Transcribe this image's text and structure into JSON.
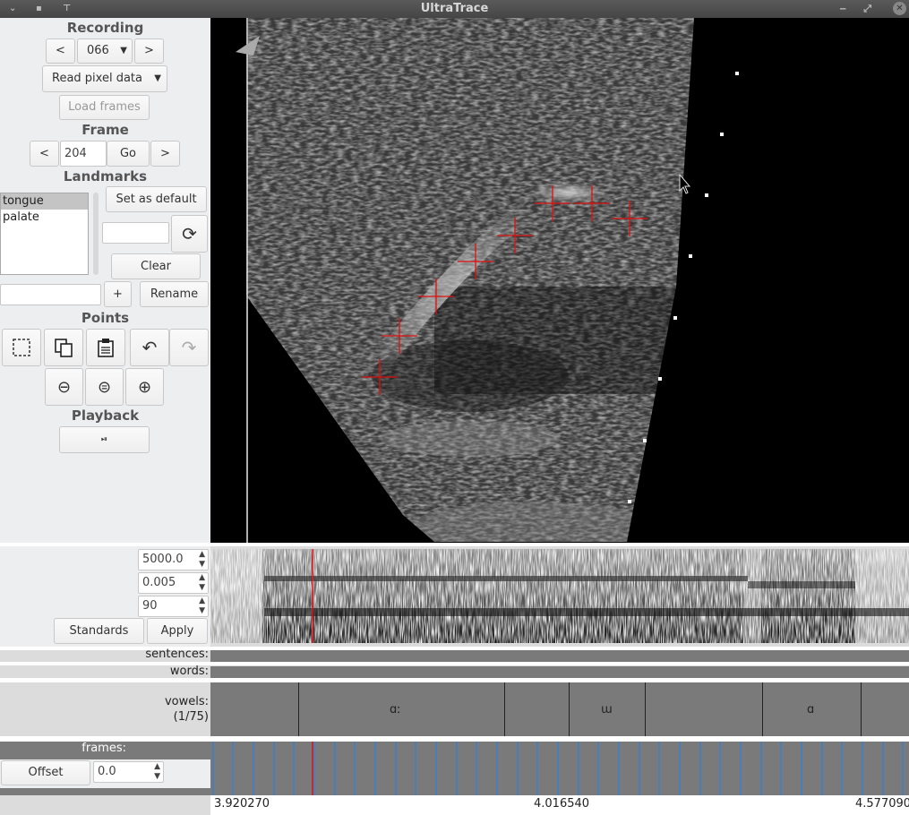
{
  "window": {
    "title": "UltraTrace"
  },
  "recording": {
    "header": "Recording",
    "prev": "<",
    "next": ">",
    "value": "066",
    "mode": "Read pixel data",
    "load": "Load frames"
  },
  "frame": {
    "header": "Frame",
    "prev": "<",
    "next": ">",
    "value": "204",
    "go": "Go"
  },
  "landmarks": {
    "header": "Landmarks",
    "items": [
      "tongue",
      "palate"
    ],
    "selected": "tongue",
    "set_default": "Set as default",
    "clear": "Clear",
    "add": "+",
    "rename": "Rename"
  },
  "points": {
    "header": "Points"
  },
  "playback": {
    "header": "Playback"
  },
  "spectrogram": {
    "max_freq": "5000.0",
    "window_len": "0.005",
    "dynamic_range": "90",
    "standards": "Standards",
    "apply": "Apply"
  },
  "tiers": {
    "sentences": "sentences:",
    "words": "words:",
    "vowels": "vowels:",
    "vowels_count": "(1/75)",
    "frames": "frames:"
  },
  "vowels": [
    "ɑː",
    "ɯ",
    "ɑ"
  ],
  "offset": {
    "button": "Offset",
    "value": "0.0"
  },
  "timeline": {
    "start": "3.920270",
    "mid": "4.016540",
    "end": "4.577090"
  },
  "colors": {
    "trace": "#e01010",
    "frame_tick": "#3a7fd0",
    "current_frame": "#e01010"
  }
}
